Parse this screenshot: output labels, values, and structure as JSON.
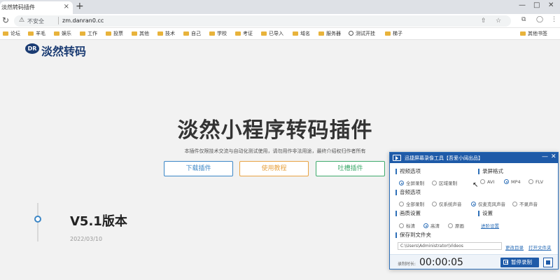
{
  "browser": {
    "tab_title": "淡然转码插件",
    "tab_close": "×",
    "new_tab": "+",
    "window_controls": {
      "minimize": "—",
      "maximize": "□",
      "close": "✕"
    },
    "reload_icon": "↻",
    "security_icon": "⚠",
    "security_text": "不安全",
    "url": "zm.danran0.cc",
    "share_icon": "⇧",
    "star_icon": "☆",
    "bookmarks": [
      {
        "label": "论坛",
        "icon": "folder-icon"
      },
      {
        "label": "羊毛",
        "icon": "folder-icon"
      },
      {
        "label": "娱乐",
        "icon": "folder-icon"
      },
      {
        "label": "工作",
        "icon": "folder-icon"
      },
      {
        "label": "投票",
        "icon": "folder-icon"
      },
      {
        "label": "其他",
        "icon": "folder-icon"
      },
      {
        "label": "技术",
        "icon": "folder-icon"
      },
      {
        "label": "自己",
        "icon": "folder-icon"
      },
      {
        "label": "学校",
        "icon": "folder-icon"
      },
      {
        "label": "考证",
        "icon": "folder-icon"
      },
      {
        "label": "已导入",
        "icon": "folder-icon"
      },
      {
        "label": "域名",
        "icon": "folder-icon"
      },
      {
        "label": "服务器",
        "icon": "folder-icon"
      },
      {
        "label": "测试开挂",
        "icon": "globe-icon"
      },
      {
        "label": "梯子",
        "icon": "folder-icon"
      }
    ],
    "other_bookmarks": "其他书签"
  },
  "page": {
    "logo_badge": "DR",
    "logo_text": "淡然转码",
    "hero_title": "淡然小程序转码插件",
    "hero_subtitle": "本插件仅限技术交流与自动化测试使用，请勿用作非法用途，最终介绍权归作者所有",
    "buttons": {
      "download": "下载插件",
      "tutorial": "使用教程",
      "feedback": "吐槽插件"
    },
    "version_title": "V5.1版本",
    "version_date": "2022/03/10"
  },
  "recorder": {
    "title": "迅捷屏幕录像工具【吾爱小阔出品】",
    "minimize": "—",
    "close": "✕",
    "video_section": "视频选项",
    "video_options": [
      "全屏录制",
      "区域录制"
    ],
    "format_section": "录屏格式",
    "format_options": [
      "AVI",
      "MP4",
      "FLV"
    ],
    "audio_section": "音频选项",
    "audio_options": [
      "全部录制",
      "仅系统声音",
      "仅麦克风声音",
      "不录声音"
    ],
    "quality_section": "画质设置",
    "quality_options": [
      "标清",
      "高清",
      "原画"
    ],
    "settings_section": "设置",
    "advanced_link": "进阶设置",
    "save_section": "保存到文件夹",
    "save_path": "C:\\Users\\Administrator\\Videos",
    "change_dir": "更改目录",
    "open_folder": "打开文件夹",
    "timer_label": "录制时长:",
    "timer": "00:00:05",
    "pause_label": "暂停录制",
    "selected": {
      "video": "全屏录制",
      "format": "MP4",
      "audio": "仅麦克风声音",
      "quality": "高清"
    },
    "accent_color": "#1e5aa8"
  },
  "cursor_icon": "↖"
}
